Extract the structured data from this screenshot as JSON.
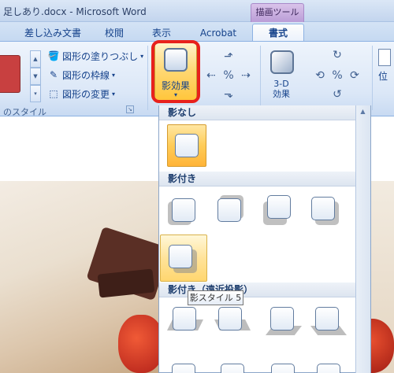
{
  "window": {
    "title": "足しあり.docx - Microsoft Word",
    "contextual_tab": "描画ツール"
  },
  "tabs": [
    {
      "label": "差し込み文書"
    },
    {
      "label": "校閲"
    },
    {
      "label": "表示"
    },
    {
      "label": "Acrobat"
    },
    {
      "label": "書式",
      "active": true
    }
  ],
  "ribbon": {
    "shape_styles": {
      "fill_label": "図形の塗りつぶし",
      "outline_label": "図形の枠線",
      "change_label": "図形の変更",
      "group_label": "のスタイル",
      "fill_color": "#c84040"
    },
    "shadow_effects_label": "影効果",
    "three_d_label_line1": "3-D",
    "three_d_label_line2": "効果",
    "position_label": "位"
  },
  "gallery": {
    "sections": [
      {
        "title": "影なし"
      },
      {
        "title": "影付き"
      },
      {
        "title": "影付き（遠近投影）"
      }
    ],
    "tooltip": "影スタイル 5"
  },
  "colors": {
    "highlight": "#e8211c",
    "selected": "#ffcc58",
    "ribbon": "#dbe7f7"
  }
}
